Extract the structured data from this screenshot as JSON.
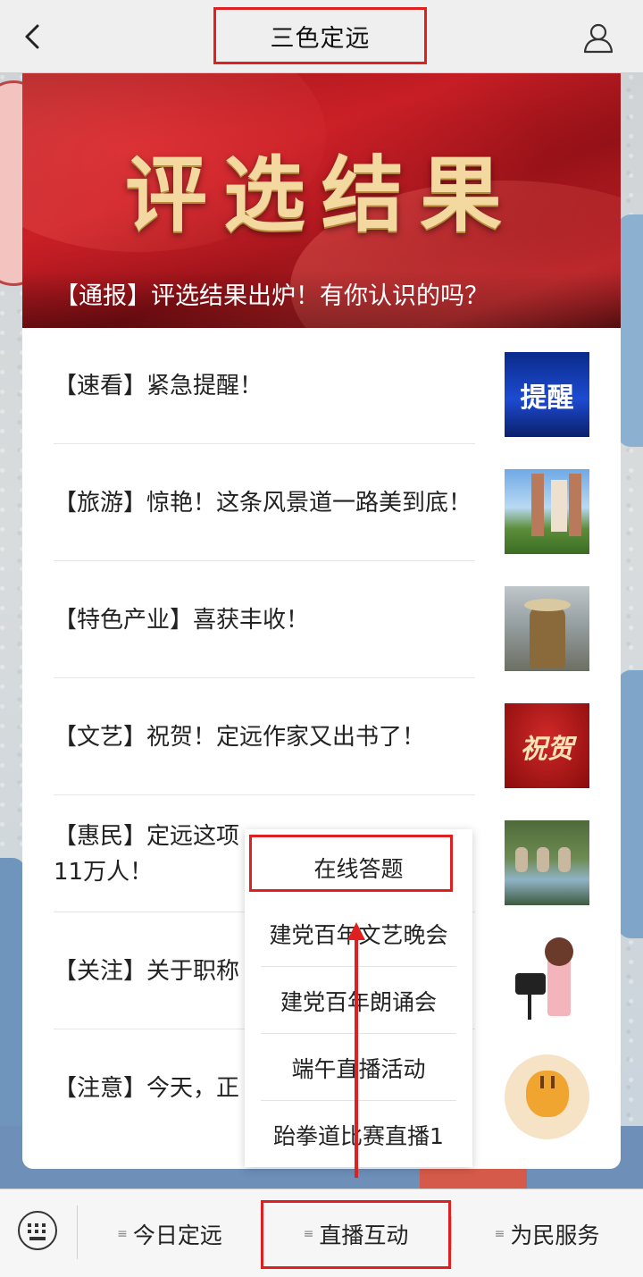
{
  "header": {
    "title": "三色定远",
    "back_icon": "chevron-left-icon",
    "user_icon": "user-icon"
  },
  "banner": {
    "title": "评选结果",
    "caption": "【通报】评选结果出炉！有你认识的吗？"
  },
  "articles": [
    {
      "title": "【速看】紧急提醒！",
      "thumb_text": "提醒"
    },
    {
      "title": "【旅游】惊艳！这条风景道一路美到底！"
    },
    {
      "title": "【特色产业】喜获丰收！"
    },
    {
      "title": "【文艺】祝贺！定远作家又出书了！",
      "thumb_text": "祝贺"
    },
    {
      "title": "【惠民】定远这项11万人！",
      "visible_line1": "【惠民】定远这项",
      "visible_line2": "11万人！"
    },
    {
      "title": "【关注】关于职称",
      "visible_line1": "【关注】关于职称"
    },
    {
      "title": "【注意】今天，正",
      "visible_line1": "【注意】今天，正"
    }
  ],
  "dropdown_menu": {
    "items": [
      "在线答题",
      "建党百年文艺晚会",
      "建党百年朗诵会",
      "端午直播活动",
      "跆拳道比赛直播1"
    ]
  },
  "tabbar": {
    "keyboard_icon": "keyboard-icon",
    "tabs": [
      {
        "label": "今日定远"
      },
      {
        "label": "直播互动"
      },
      {
        "label": "为民服务"
      }
    ],
    "menu_glyph": "≡"
  },
  "colors": {
    "highlight": "#e02020",
    "banner_red": "#c41d24",
    "banner_gold": "#f3d9a0"
  }
}
